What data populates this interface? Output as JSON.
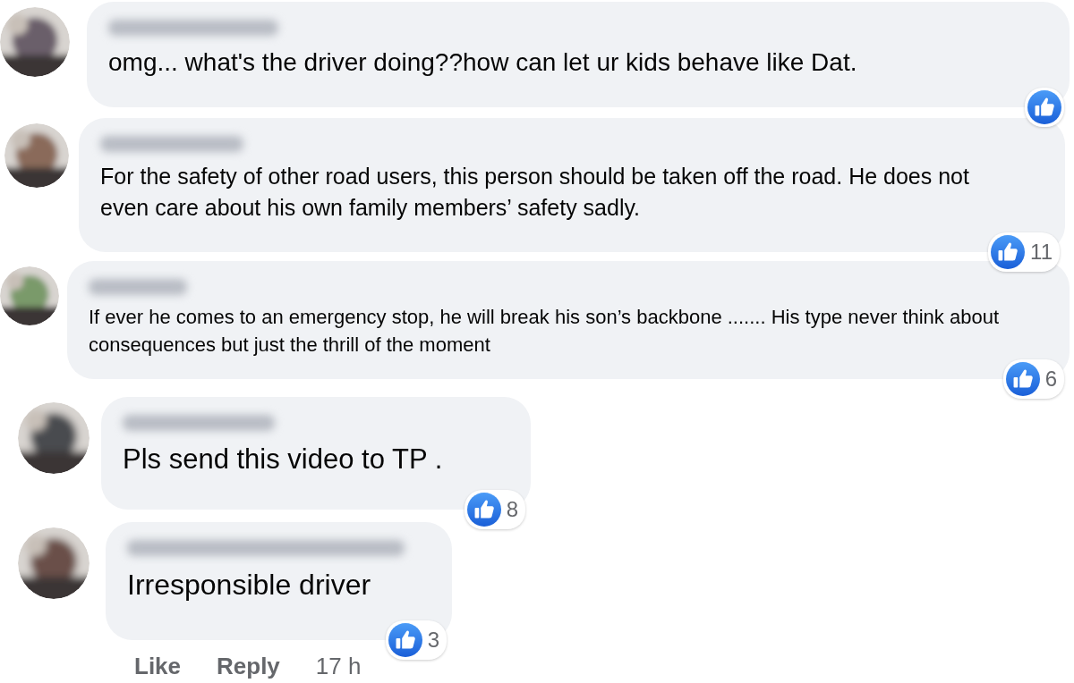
{
  "comments": [
    {
      "text": "omg... what's the driver doing??how can let ur kids behave like Dat."
    },
    {
      "text": "For the safety of other road users, this person should be taken off the road. He does not even care about his own family members’ safety sadly.",
      "reactions": "11"
    },
    {
      "text": "If ever he comes to an emergency stop, he will break his son’s backbone ....... His type never think about consequences but just the thrill of the moment",
      "reactions": "6"
    },
    {
      "text": "Pls send this video to TP .",
      "reactions": "8"
    },
    {
      "text": "Irresponsible driver",
      "reactions": "3"
    }
  ],
  "actions": {
    "like": "Like",
    "reply": "Reply",
    "time": "17 h"
  }
}
